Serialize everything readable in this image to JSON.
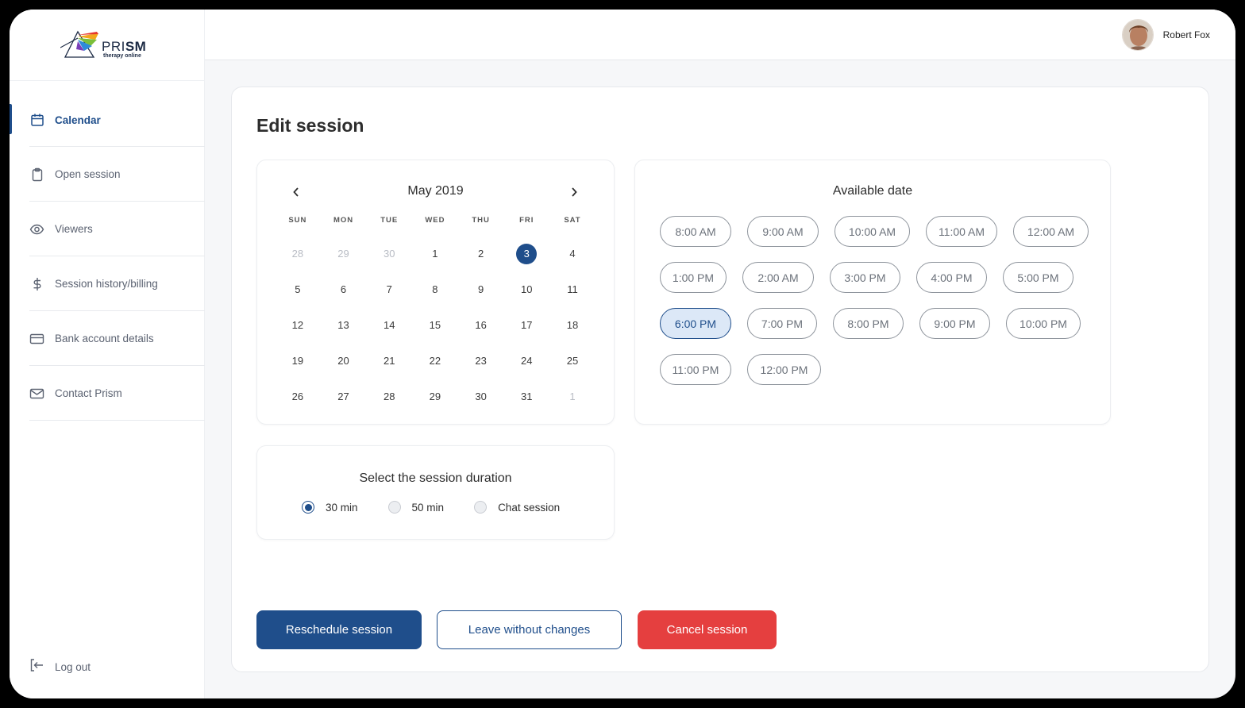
{
  "brand": {
    "name_light": "PRI",
    "name_bold": "SM",
    "tagline": "therapy online",
    "colors": {
      "accent": "#1f4e8b",
      "danger": "#e53f3f"
    }
  },
  "user": {
    "name": "Robert Fox"
  },
  "sidebar": {
    "items": [
      {
        "label": "Calendar",
        "icon": "calendar-icon",
        "active": true
      },
      {
        "label": "Open session",
        "icon": "clipboard-icon",
        "active": false
      },
      {
        "label": "Viewers",
        "icon": "eye-icon",
        "active": false
      },
      {
        "label": "Session history/billing",
        "icon": "dollar-icon",
        "active": false
      },
      {
        "label": "Bank account details",
        "icon": "credit-card-icon",
        "active": false
      },
      {
        "label": "Contact Prism",
        "icon": "mail-icon",
        "active": false
      }
    ],
    "logout_label": "Log out"
  },
  "page": {
    "title": "Edit session"
  },
  "calendar": {
    "month_label": "May 2019",
    "weekdays": [
      "SUN",
      "MON",
      "TUE",
      "WED",
      "THU",
      "FRI",
      "SAT"
    ],
    "selected_day": "3",
    "days": [
      {
        "d": "28",
        "muted": true
      },
      {
        "d": "29",
        "muted": true
      },
      {
        "d": "30",
        "muted": true
      },
      {
        "d": "1"
      },
      {
        "d": "2"
      },
      {
        "d": "3"
      },
      {
        "d": "4"
      },
      {
        "d": "5"
      },
      {
        "d": "6"
      },
      {
        "d": "7"
      },
      {
        "d": "8"
      },
      {
        "d": "9"
      },
      {
        "d": "10"
      },
      {
        "d": "11"
      },
      {
        "d": "12"
      },
      {
        "d": "13"
      },
      {
        "d": "14"
      },
      {
        "d": "15"
      },
      {
        "d": "16"
      },
      {
        "d": "17"
      },
      {
        "d": "18"
      },
      {
        "d": "19"
      },
      {
        "d": "20"
      },
      {
        "d": "21"
      },
      {
        "d": "22"
      },
      {
        "d": "23"
      },
      {
        "d": "24"
      },
      {
        "d": "25"
      },
      {
        "d": "26"
      },
      {
        "d": "27"
      },
      {
        "d": "28"
      },
      {
        "d": "29"
      },
      {
        "d": "30"
      },
      {
        "d": "31"
      },
      {
        "d": "1",
        "muted": true
      }
    ]
  },
  "available": {
    "title": "Available date",
    "selected": "6:00 PM",
    "rows": [
      [
        "8:00 AM",
        "9:00 AM",
        "10:00 AM",
        "11:00 AM",
        "12:00 AM"
      ],
      [
        "1:00 PM",
        "2:00 AM",
        "3:00 PM",
        "4:00 PM",
        "5:00 PM"
      ],
      [
        "6:00 PM",
        "7:00 PM",
        "8:00 PM",
        "9:00 PM",
        "10:00 PM"
      ],
      [
        "11:00 PM",
        "12:00 PM"
      ]
    ]
  },
  "duration": {
    "title": "Select the session duration",
    "selected": "30 min",
    "options": [
      "30 min",
      "50 min",
      "Chat session"
    ]
  },
  "actions": {
    "reschedule": "Reschedule session",
    "leave": "Leave without changes",
    "cancel": "Cancel session"
  }
}
